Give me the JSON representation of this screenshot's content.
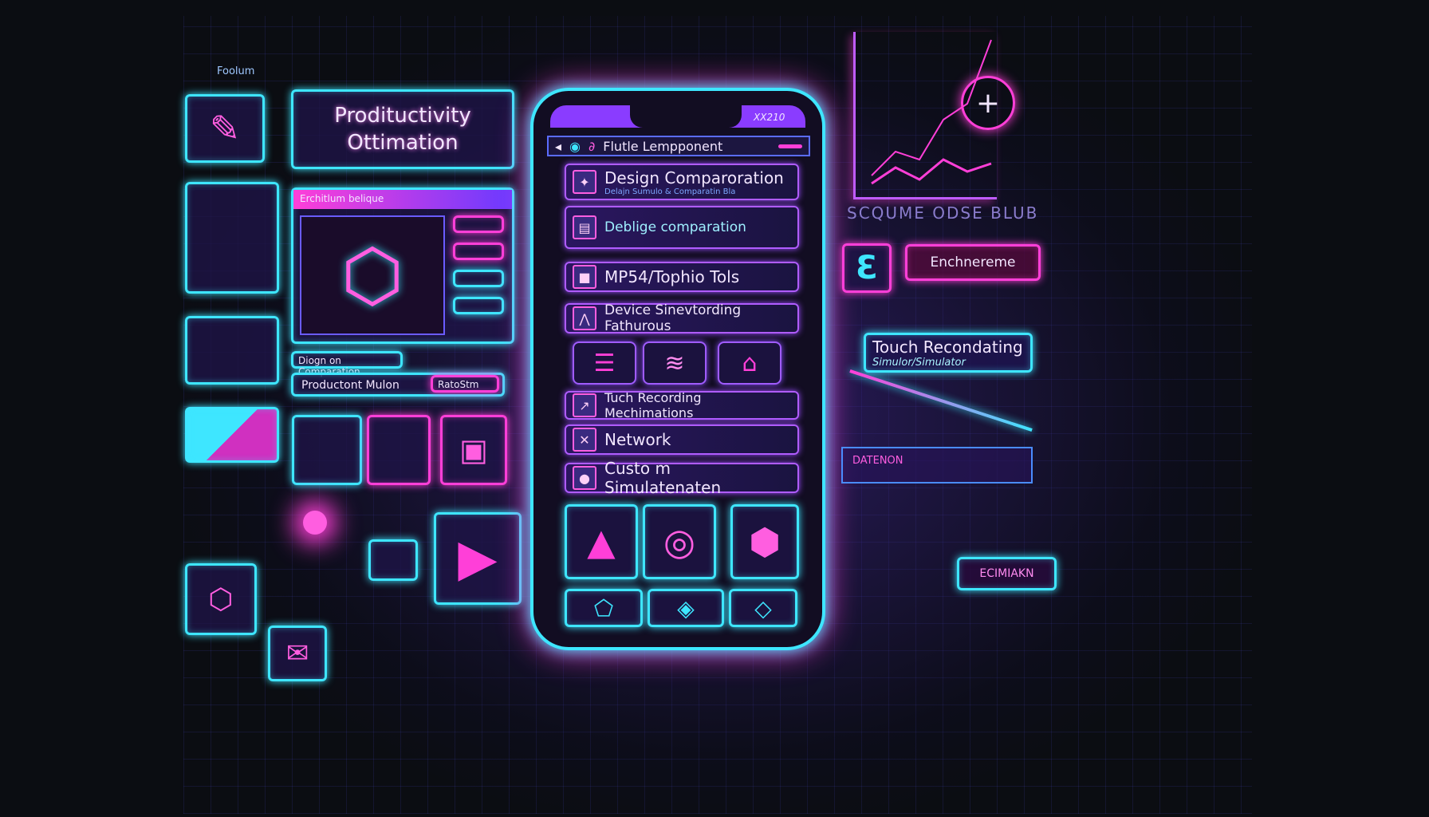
{
  "left": {
    "corner_label": "Foolum",
    "title_card": {
      "line1": "Prodituctivity",
      "line2": "Ottimation"
    },
    "editor_panel": {
      "header": "Erchitlum belique"
    },
    "buttons": {
      "comparison": "Diogn on Comparation",
      "product": "Productont Mulon",
      "raster": "RatoStm"
    }
  },
  "phone": {
    "status_code": "XX210",
    "app_header": "Flutle Lempponent",
    "items": [
      {
        "title": "Design Comparoration",
        "subtitle": "Delajn Sumulo & Comparatin Bla"
      },
      {
        "title": "Deblige comparation"
      },
      {
        "title": "MP54/Tophio Tols"
      },
      {
        "title": "Device Sinevtording Fathurous"
      },
      {
        "title": "Tuch Recording Mechimations"
      },
      {
        "title": "Network"
      },
      {
        "title": "Custo m Simulatenaten"
      }
    ]
  },
  "right": {
    "chart_caption": "SCQUME ODSE BLUB",
    "callout": "Enchnereme",
    "touch_card": {
      "title": "Touch Recondating",
      "subtitle": "Simulor/Simulator"
    },
    "banner": "DATENON",
    "tag": "ECIMIAKN"
  },
  "colors": {
    "cyan": "#3ee6ff",
    "magenta": "#ff3fd8",
    "violet": "#a05cff",
    "background": "#0b0d12"
  }
}
